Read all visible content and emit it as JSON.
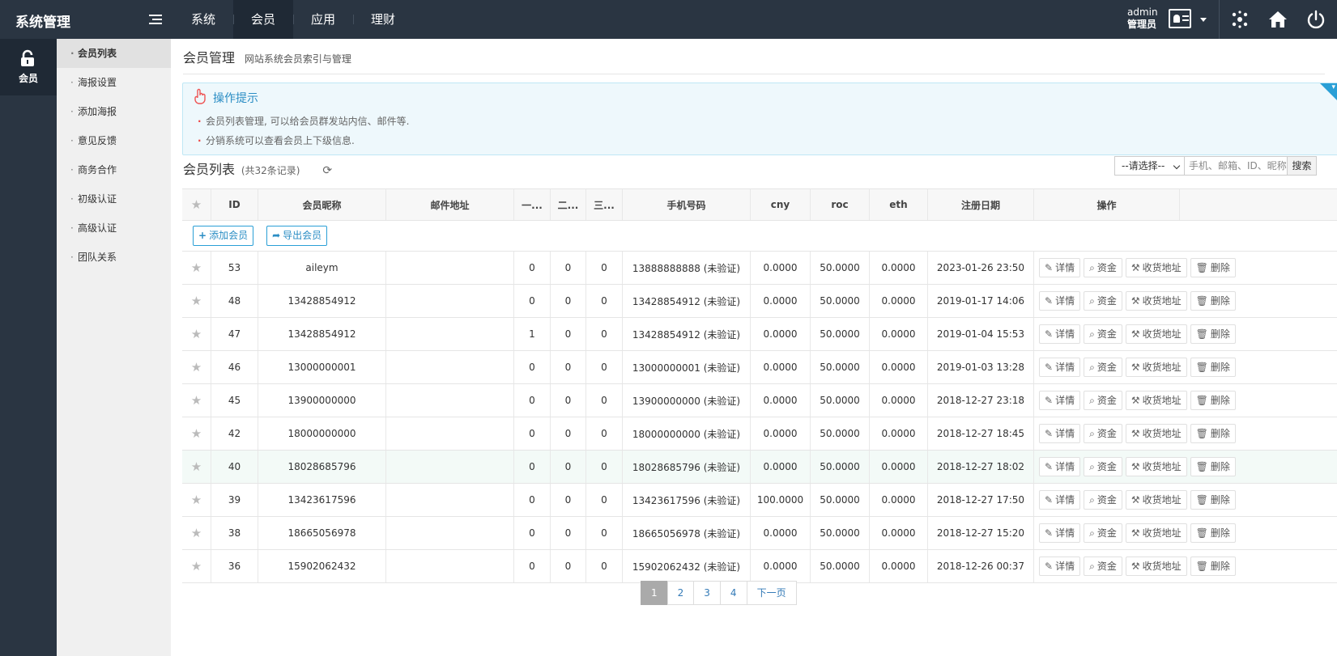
{
  "app": {
    "title": "系统管理"
  },
  "topnav": [
    {
      "label": "系统"
    },
    {
      "label": "会员"
    },
    {
      "label": "应用"
    },
    {
      "label": "理财"
    }
  ],
  "user": {
    "name": "admin",
    "role": "管理员"
  },
  "sidebar": {
    "label": "会员"
  },
  "submenu": [
    {
      "label": "会员列表"
    },
    {
      "label": "海报设置"
    },
    {
      "label": "添加海报"
    },
    {
      "label": "意见反馈"
    },
    {
      "label": "商务合作"
    },
    {
      "label": "初级认证"
    },
    {
      "label": "高级认证"
    },
    {
      "label": "团队关系"
    }
  ],
  "page": {
    "title": "会员管理",
    "subtitle": "网站系统会员索引与管理"
  },
  "tips": {
    "title": "操作提示",
    "items": [
      "会员列表管理, 可以给会员群发站内信、邮件等.",
      "分销系统可以查看会员上下级信息."
    ]
  },
  "list": {
    "title": "会员列表",
    "count": "(共32条记录)"
  },
  "search": {
    "select": "--请选择--",
    "placeholder": "手机、邮箱、ID、昵称",
    "button": "搜索"
  },
  "toolbar": {
    "add": "添加会员",
    "export": "导出会员"
  },
  "columns": {
    "id": "ID",
    "nick": "会员昵称",
    "mail": "邮件地址",
    "l1": "一...",
    "l2": "二...",
    "l3": "三...",
    "phone": "手机号码",
    "cny": "cny",
    "roc": "roc",
    "eth": "eth",
    "date": "注册日期",
    "ops": "操作"
  },
  "ops": {
    "detail": "详情",
    "funds": "资金",
    "address": "收货地址",
    "delete": "删除"
  },
  "rows": [
    {
      "id": "53",
      "nick": "aileym",
      "mail": "",
      "l1": "0",
      "l2": "0",
      "l3": "0",
      "phone": "13888888888 (未验证)",
      "cny": "0.0000",
      "roc": "50.0000",
      "eth": "0.0000",
      "date": "2023-01-26 23:50"
    },
    {
      "id": "48",
      "nick": "13428854912",
      "mail": "",
      "l1": "0",
      "l2": "0",
      "l3": "0",
      "phone": "13428854912 (未验证)",
      "cny": "0.0000",
      "roc": "50.0000",
      "eth": "0.0000",
      "date": "2019-01-17 14:06"
    },
    {
      "id": "47",
      "nick": "13428854912",
      "mail": "",
      "l1": "1",
      "l2": "0",
      "l3": "0",
      "phone": "13428854912 (未验证)",
      "cny": "0.0000",
      "roc": "50.0000",
      "eth": "0.0000",
      "date": "2019-01-04 15:53"
    },
    {
      "id": "46",
      "nick": "13000000001",
      "mail": "",
      "l1": "0",
      "l2": "0",
      "l3": "0",
      "phone": "13000000001 (未验证)",
      "cny": "0.0000",
      "roc": "50.0000",
      "eth": "0.0000",
      "date": "2019-01-03 13:28"
    },
    {
      "id": "45",
      "nick": "13900000000",
      "mail": "",
      "l1": "0",
      "l2": "0",
      "l3": "0",
      "phone": "13900000000 (未验证)",
      "cny": "0.0000",
      "roc": "50.0000",
      "eth": "0.0000",
      "date": "2018-12-27 23:18"
    },
    {
      "id": "42",
      "nick": "18000000000",
      "mail": "",
      "l1": "0",
      "l2": "0",
      "l3": "0",
      "phone": "18000000000 (未验证)",
      "cny": "0.0000",
      "roc": "50.0000",
      "eth": "0.0000",
      "date": "2018-12-27 18:45"
    },
    {
      "id": "40",
      "nick": "18028685796",
      "mail": "",
      "l1": "0",
      "l2": "0",
      "l3": "0",
      "phone": "18028685796 (未验证)",
      "cny": "0.0000",
      "roc": "50.0000",
      "eth": "0.0000",
      "date": "2018-12-27 18:02"
    },
    {
      "id": "39",
      "nick": "13423617596",
      "mail": "",
      "l1": "0",
      "l2": "0",
      "l3": "0",
      "phone": "13423617596 (未验证)",
      "cny": "100.0000",
      "roc": "50.0000",
      "eth": "0.0000",
      "date": "2018-12-27 17:50"
    },
    {
      "id": "38",
      "nick": "18665056978",
      "mail": "",
      "l1": "0",
      "l2": "0",
      "l3": "0",
      "phone": "18665056978 (未验证)",
      "cny": "0.0000",
      "roc": "50.0000",
      "eth": "0.0000",
      "date": "2018-12-27 15:20"
    },
    {
      "id": "36",
      "nick": "15902062432",
      "mail": "",
      "l1": "0",
      "l2": "0",
      "l3": "0",
      "phone": "15902062432 (未验证)",
      "cny": "0.0000",
      "roc": "50.0000",
      "eth": "0.0000",
      "date": "2018-12-26 00:37"
    }
  ],
  "pagination": [
    "1",
    "2",
    "3",
    "4",
    "下一页"
  ],
  "colors": {
    "topbar": "#2a3542",
    "accent": "#2a9fd6",
    "tips_bg": "#eef8fc"
  }
}
